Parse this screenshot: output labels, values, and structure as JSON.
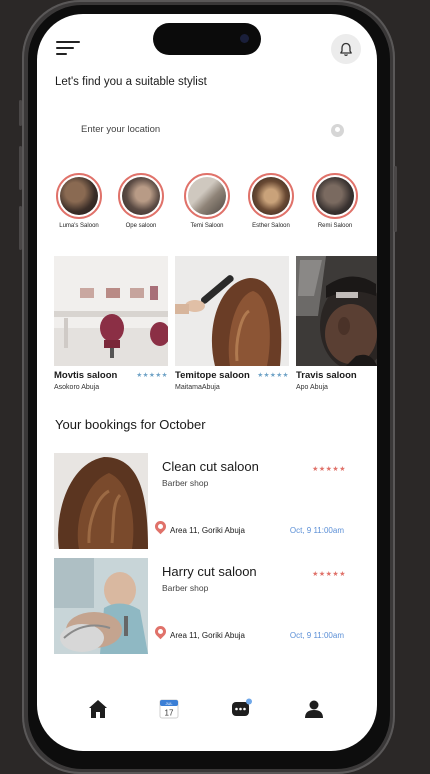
{
  "header": {
    "greeting": "Let's find you a suitable stylist"
  },
  "search": {
    "placeholder": "Enter your location"
  },
  "stories": [
    {
      "label": "Luma's Saloon"
    },
    {
      "label": "Ope saloon"
    },
    {
      "label": "Temi Saloon"
    },
    {
      "label": "Esther Saloon"
    },
    {
      "label": "Remi Saloon"
    }
  ],
  "featured": [
    {
      "name": "Movtis saloon",
      "location": "Asokoro Abuja",
      "stars": "★★★★★"
    },
    {
      "name": "Temitope saloon",
      "location": "MaitamaAbuja",
      "stars": "★★★★★"
    },
    {
      "name": "Travis saloon",
      "location": "Apo Abuja",
      "stars": ""
    }
  ],
  "bookings_section": {
    "title": "Your bookings for  October"
  },
  "bookings": [
    {
      "name": "Clean cut saloon",
      "type": "Barber shop",
      "stars": "★★★★★",
      "address": "Area 11, Goriki Abuja",
      "date": "Oct, 9 11:00am"
    },
    {
      "name": "Harry cut saloon",
      "type": "Barber shop",
      "stars": "★★★★★",
      "address": "Area 11, Goriki Abuja",
      "date": "Oct, 9 11:00am"
    }
  ],
  "tabbar": {
    "calendar_month": "JUL",
    "calendar_day": "17"
  },
  "colors": {
    "accent_coral": "#e0726a",
    "link_blue": "#5b8fd6",
    "star_blue": "#6ea2c6"
  }
}
